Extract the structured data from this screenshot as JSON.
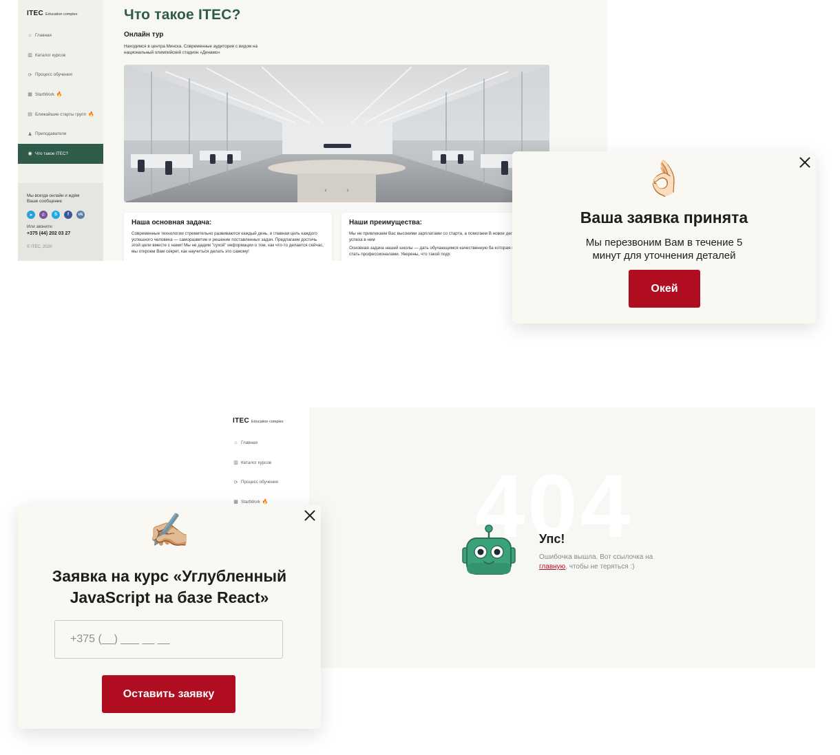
{
  "screen1": {
    "logo": {
      "main": "ITEC",
      "sub": "Education complex"
    },
    "nav": [
      {
        "icon": "home-icon",
        "glyph": "⌂",
        "label": "Главная",
        "fire": false
      },
      {
        "icon": "book-icon",
        "glyph": "▥",
        "label": "Каталог курсов",
        "fire": false
      },
      {
        "icon": "cycle-icon",
        "glyph": "⟳",
        "label": "Процесс обучения",
        "fire": false
      },
      {
        "icon": "briefcase-icon",
        "glyph": "▦",
        "label": "StartWork",
        "fire": true
      },
      {
        "icon": "calendar-icon",
        "glyph": "▤",
        "label": "Ближайшие старты групп",
        "fire": true
      },
      {
        "icon": "teachers-icon",
        "glyph": "♟",
        "label": "Преподаватели",
        "fire": false
      },
      {
        "icon": "info-icon",
        "glyph": "◉",
        "label": "Что такое ITEC?",
        "fire": false,
        "active": true
      }
    ],
    "contact": {
      "text": "Мы всегда онлайн и ждём Ваше сообщение",
      "socials": [
        {
          "name": "telegram-icon",
          "glyph": "➤",
          "color": "#2a9fd8"
        },
        {
          "name": "viber-icon",
          "glyph": "✆",
          "color": "#7d519a"
        },
        {
          "name": "skype-icon",
          "glyph": "S",
          "color": "#1fa9e6"
        },
        {
          "name": "facebook-icon",
          "glyph": "f",
          "color": "#3b5998"
        },
        {
          "name": "vk-icon",
          "glyph": "vk",
          "color": "#5b7fa6"
        }
      ],
      "call_label": "Или звоните:",
      "phone": "+375 (44) 202 03 27",
      "copyright": "© ITEC, 2020"
    },
    "title": "Что такое ITEC?",
    "tour_title": "Онлайн тур",
    "tour_desc": "Находимся в центра Минска. Современные аудитории с видом на национальный олимпийский стадион «Динамо»",
    "card1": {
      "title": "Наша основная задача:",
      "text": "Современные технологии стремительно развиваются каждый день, и главная цель каждого успешного человека — саморазвитие и решение поставленных задач. Предлагаем достичь этой цели вместе с нами! Мы не дадим \"сухой\" информации о том, как что-то делается сейчас, мы откроем Вам секрет, как научиться делать это самому!"
    },
    "card2": {
      "title": "Наши преимущества:",
      "text1": "Мы не привлекаем Вас высокими зарплатами со старта, а помогаем В новое дело и добиться успеха в нем",
      "text2": "Основная задача нашей школы — дать обучающимся качественную ба которая поможет им стать профессионалами. Уверены, что такой подх"
    }
  },
  "modal_ok": {
    "emoji": "👌🏻",
    "title": "Ваша заявка принята",
    "text": "Мы перезвоним Вам в течение 5 минут для уточнения деталей",
    "button": "Окей"
  },
  "screen2": {
    "logo": {
      "main": "ITEC",
      "sub": "Education complex"
    },
    "nav": [
      {
        "icon": "home-icon",
        "glyph": "⌂",
        "label": "Главная",
        "fire": false
      },
      {
        "icon": "book-icon",
        "glyph": "▥",
        "label": "Каталог курсов",
        "fire": false
      },
      {
        "icon": "cycle-icon",
        "glyph": "⟳",
        "label": "Процесс обучения",
        "fire": false
      },
      {
        "icon": "briefcase-icon",
        "glyph": "▦",
        "label": "StartWork",
        "fire": true
      }
    ],
    "code": "404",
    "title": "Упс!",
    "text_before": "Ошибочка вышла. Вот ссылочка на ",
    "link": "главную",
    "text_after": ", чтобы не теряться :)"
  },
  "modal_form": {
    "emoji": "✍🏼",
    "title": "Заявка на курс «Углубленный JavaScript на базе React»",
    "phone_placeholder": "+375 (__) ___ __ __",
    "button": "Оставить заявку"
  },
  "colors": {
    "brand_green": "#2f5b4b",
    "accent_red": "#b10d21",
    "page_bg": "#f7f7f3",
    "robot_green": "#3aa37a"
  }
}
